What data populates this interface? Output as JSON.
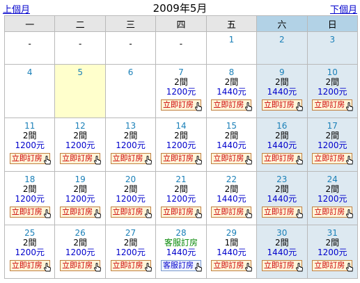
{
  "header": {
    "prev_label": "上個月",
    "next_label": "下個月",
    "month_title": "2009年5月"
  },
  "weekdays": [
    "一",
    "二",
    "三",
    "四",
    "五",
    "六",
    "日"
  ],
  "weeks": [
    [
      {
        "dash": "-"
      },
      {
        "dash": "-"
      },
      {
        "dash": "-"
      },
      {
        "dash": "-"
      },
      {
        "day": "1"
      },
      {
        "day": "2"
      },
      {
        "day": "3"
      }
    ],
    [
      {
        "day": "4"
      },
      {
        "day": "5",
        "today": true
      },
      {
        "day": "6"
      },
      {
        "day": "7",
        "rooms": "2間",
        "price": "1200元",
        "button": "立即訂房"
      },
      {
        "day": "8",
        "rooms": "2間",
        "price": "1440元",
        "button": "立即訂房"
      },
      {
        "day": "9",
        "rooms": "2間",
        "price": "1440元",
        "button": "立即訂房"
      },
      {
        "day": "10",
        "rooms": "2間",
        "price": "1200元",
        "button": "立即訂房"
      }
    ],
    [
      {
        "day": "11",
        "rooms": "2間",
        "price": "1200元",
        "button": "立即訂房"
      },
      {
        "day": "12",
        "rooms": "2間",
        "price": "1200元",
        "button": "立即訂房"
      },
      {
        "day": "13",
        "rooms": "2間",
        "price": "1200元",
        "button": "立即訂房"
      },
      {
        "day": "14",
        "rooms": "2間",
        "price": "1200元",
        "button": "立即訂房"
      },
      {
        "day": "15",
        "rooms": "2間",
        "price": "1440元",
        "button": "立即訂房"
      },
      {
        "day": "16",
        "rooms": "2間",
        "price": "1440元",
        "button": "立即訂房"
      },
      {
        "day": "17",
        "rooms": "2間",
        "price": "1200元",
        "button": "立即訂房"
      }
    ],
    [
      {
        "day": "18",
        "rooms": "2間",
        "price": "1200元",
        "button": "立即訂房"
      },
      {
        "day": "19",
        "rooms": "2間",
        "price": "1200元",
        "button": "立即訂房"
      },
      {
        "day": "20",
        "rooms": "2間",
        "price": "1200元",
        "button": "立即訂房"
      },
      {
        "day": "21",
        "rooms": "2間",
        "price": "1200元",
        "button": "立即訂房"
      },
      {
        "day": "22",
        "rooms": "2間",
        "price": "1440元",
        "button": "立即訂房"
      },
      {
        "day": "23",
        "rooms": "2間",
        "price": "1440元",
        "button": "立即訂房"
      },
      {
        "day": "24",
        "rooms": "2間",
        "price": "1200元",
        "button": "立即訂房"
      }
    ],
    [
      {
        "day": "25",
        "rooms": "2間",
        "price": "1200元",
        "button": "立即訂房"
      },
      {
        "day": "26",
        "rooms": "2間",
        "price": "1200元",
        "button": "立即訂房"
      },
      {
        "day": "27",
        "rooms": "2間",
        "price": "1200元",
        "button": "立即訂房"
      },
      {
        "day": "28",
        "rooms": "客服訂房",
        "rooms_green": true,
        "price": "1440元",
        "button": "客服訂房",
        "service": true
      },
      {
        "day": "29",
        "rooms": "1間",
        "price": "1440元",
        "button": "立即訂房"
      },
      {
        "day": "30",
        "rooms": "2間",
        "price": "1440元",
        "button": "立即訂房"
      },
      {
        "day": "31",
        "rooms": "2間",
        "price": "1200元",
        "button": "立即訂房"
      }
    ]
  ]
}
